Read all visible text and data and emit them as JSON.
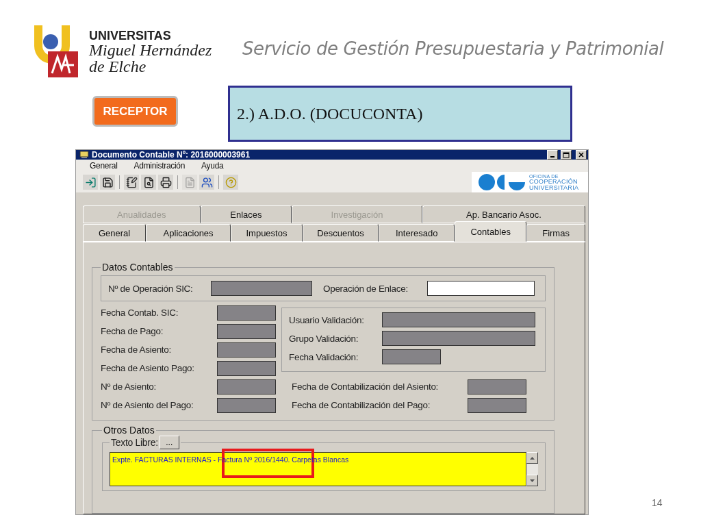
{
  "header": {
    "logo_lines": [
      "UNIVERSITAS",
      "Miguel Hernández",
      "de Elche"
    ],
    "title": "Servicio de Gestión Presupuestaria y Patrimonial"
  },
  "receptor_button": "RECEPTOR",
  "step_box": "2.) A.D.O. (DOCUCONTA)",
  "page_number": "14",
  "window": {
    "title": "Documento Contable Nº: 2016000003961",
    "menu": [
      "General",
      "Administración",
      "Ayuda"
    ],
    "toolbar_logo": [
      "OFICINA DE",
      "COOPERACIÓN",
      "UNIVERSITARIA"
    ],
    "tab_rows": [
      [
        {
          "label": "Anualidades",
          "disabled": true,
          "selected": false
        },
        {
          "label": "Enlaces",
          "disabled": false,
          "selected": false
        },
        {
          "label": "Investigación",
          "disabled": true,
          "selected": false
        },
        {
          "label": "Ap. Bancario Asoc.",
          "disabled": false,
          "selected": false
        }
      ],
      [
        {
          "label": "General",
          "disabled": false,
          "selected": false
        },
        {
          "label": "Aplicaciones",
          "disabled": false,
          "selected": false
        },
        {
          "label": "Impuestos",
          "disabled": false,
          "selected": false
        },
        {
          "label": "Descuentos",
          "disabled": false,
          "selected": false
        },
        {
          "label": "Interesado",
          "disabled": false,
          "selected": false
        },
        {
          "label": "Contables",
          "disabled": false,
          "selected": true
        },
        {
          "label": "Firmas",
          "disabled": false,
          "selected": false
        }
      ]
    ],
    "datos_contables": {
      "title": "Datos Contables",
      "top_fields": [
        {
          "label": "Nº de Operación SIC:",
          "disabled": true
        },
        {
          "label": "Operación de Enlace:",
          "disabled": false
        }
      ],
      "left_fields": [
        {
          "label": "Fecha Contab. SIC:",
          "disabled": true
        },
        {
          "label": "Fecha de Pago:",
          "disabled": true
        },
        {
          "label": "Fecha de Asiento:",
          "disabled": true
        },
        {
          "label": "Fecha de Asiento Pago:",
          "disabled": true
        },
        {
          "label": "Nº de Asiento:",
          "disabled": true
        },
        {
          "label": "Nº de Asiento del Pago:",
          "disabled": true
        }
      ],
      "validation_fields": [
        {
          "label": "Usuario Validación:",
          "kind": "wide",
          "disabled": true
        },
        {
          "label": "Grupo Validación:",
          "kind": "wide",
          "disabled": true
        },
        {
          "label": "Fecha Validación:",
          "kind": "short",
          "disabled": true
        }
      ],
      "contabilizacion_fields": [
        {
          "label": "Fecha de Contabilización del Asiento:",
          "disabled": true
        },
        {
          "label": "Fecha de Contabilización del Pago:",
          "disabled": true
        }
      ]
    },
    "otros_datos": {
      "title": "Otros Datos",
      "texto_libre_label": "Texto Libre:",
      "ellipsis_button": "...",
      "texto_libre": "Expte. FACTURAS INTERNAS - Factura Nº 2016/1440. Carpetas Blancas"
    }
  }
}
